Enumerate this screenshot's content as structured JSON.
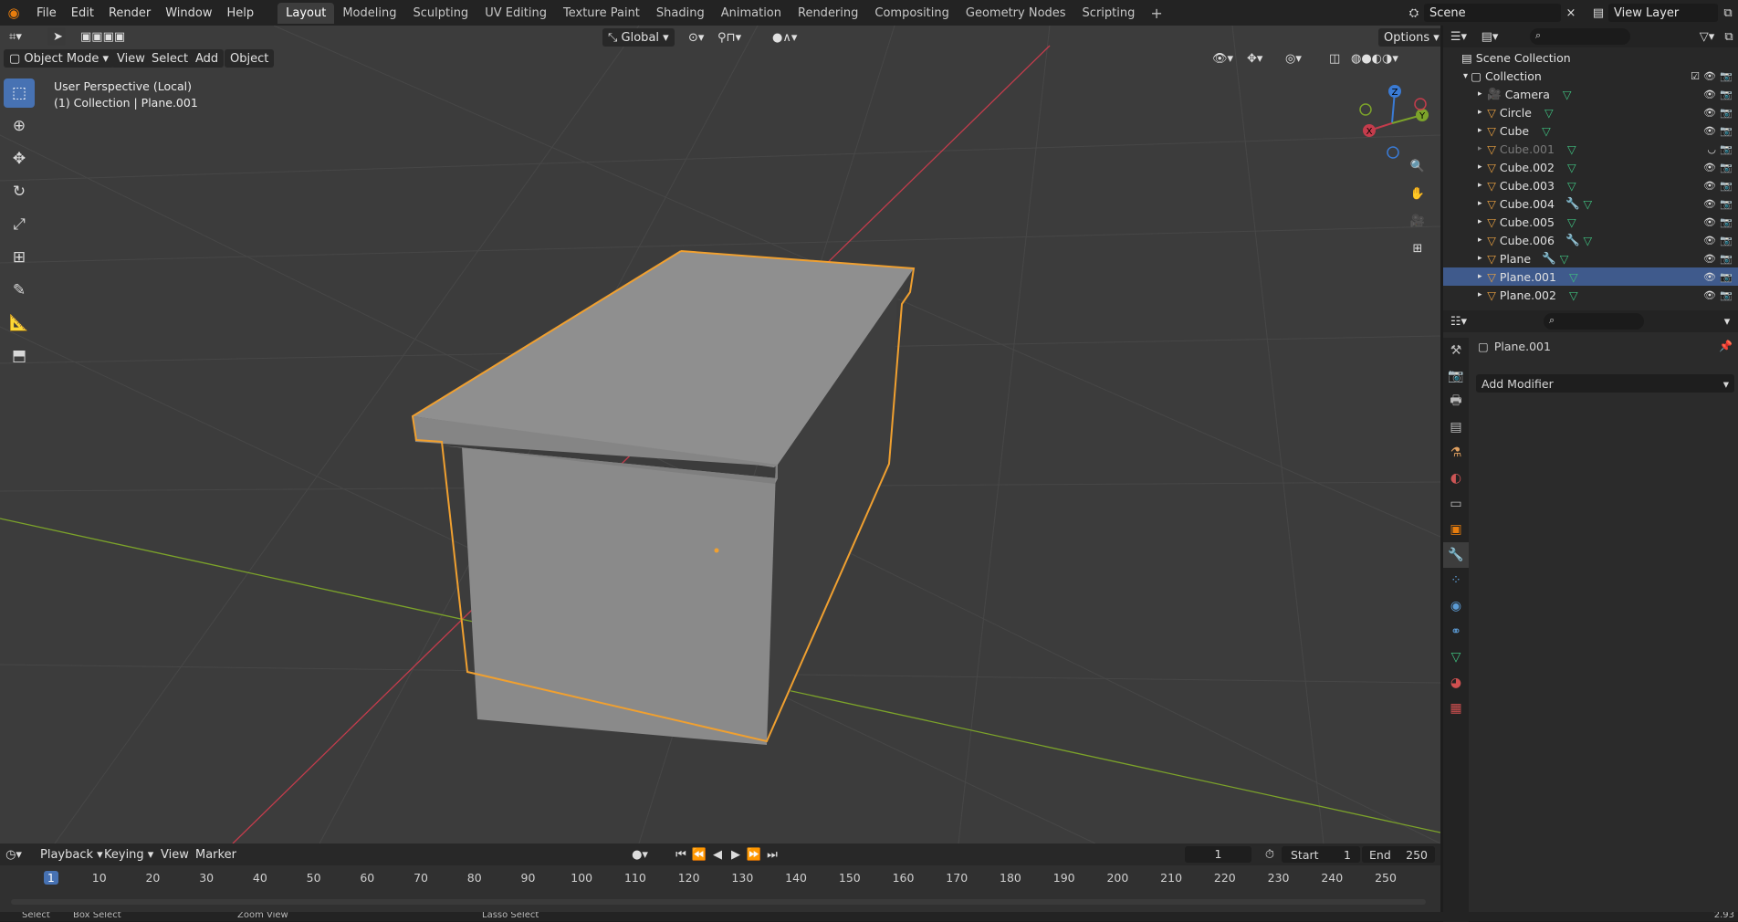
{
  "topbar": {
    "menus": [
      "File",
      "Edit",
      "Render",
      "Window",
      "Help"
    ],
    "workspaces": [
      "Layout",
      "Modeling",
      "Sculpting",
      "UV Editing",
      "Texture Paint",
      "Shading",
      "Animation",
      "Rendering",
      "Compositing",
      "Geometry Nodes",
      "Scripting"
    ],
    "active_workspace": "Layout",
    "scene": "Scene",
    "view_layer": "View Layer"
  },
  "viewport": {
    "mode": "Object Mode",
    "menus": [
      "View",
      "Select",
      "Add",
      "Object"
    ],
    "transform_orientation": "Global",
    "options_label": "Options",
    "perspective_label": "User Perspective (Local)",
    "collection_label": "(1) Collection | Plane.001",
    "gizmo": {
      "x": "X",
      "y": "Y",
      "z": "Z"
    }
  },
  "outliner": {
    "root": "Scene Collection",
    "collection": "Collection",
    "items": [
      {
        "name": "Camera",
        "type": "camera",
        "hidden": false
      },
      {
        "name": "Circle",
        "type": "mesh",
        "hidden": false
      },
      {
        "name": "Cube",
        "type": "mesh",
        "hidden": false
      },
      {
        "name": "Cube.001",
        "type": "mesh",
        "hidden": true
      },
      {
        "name": "Cube.002",
        "type": "mesh",
        "hidden": false
      },
      {
        "name": "Cube.003",
        "type": "mesh",
        "hidden": false
      },
      {
        "name": "Cube.004",
        "type": "mesh",
        "modifier": true,
        "hidden": false
      },
      {
        "name": "Cube.005",
        "type": "mesh",
        "hidden": false
      },
      {
        "name": "Cube.006",
        "type": "mesh",
        "modifier": true,
        "hidden": false
      },
      {
        "name": "Plane",
        "type": "mesh",
        "modifier": true,
        "hidden": false
      },
      {
        "name": "Plane.001",
        "type": "mesh",
        "selected": true,
        "hidden": false
      },
      {
        "name": "Plane.002",
        "type": "mesh",
        "hidden": false
      }
    ]
  },
  "properties": {
    "object_name": "Plane.001",
    "add_modifier": "Add Modifier"
  },
  "timeline": {
    "menus": [
      "Playback",
      "Keying",
      "View",
      "Marker"
    ],
    "current_frame": "1",
    "start_label": "Start",
    "start": "1",
    "end_label": "End",
    "end": "250",
    "ticks": [
      "1",
      "10",
      "20",
      "30",
      "40",
      "50",
      "60",
      "70",
      "80",
      "90",
      "100",
      "110",
      "120",
      "130",
      "140",
      "150",
      "160",
      "170",
      "180",
      "190",
      "200",
      "210",
      "220",
      "230",
      "240",
      "250"
    ]
  },
  "statusbar": {
    "items": [
      "Select",
      "Box Select",
      "Zoom View",
      "Lasso Select"
    ],
    "version": "2.93"
  },
  "colors": {
    "accent": "#4772b3",
    "selection_outline": "#f0a030",
    "x_axis": "#c43c4c",
    "y_axis": "#7ca32a"
  }
}
